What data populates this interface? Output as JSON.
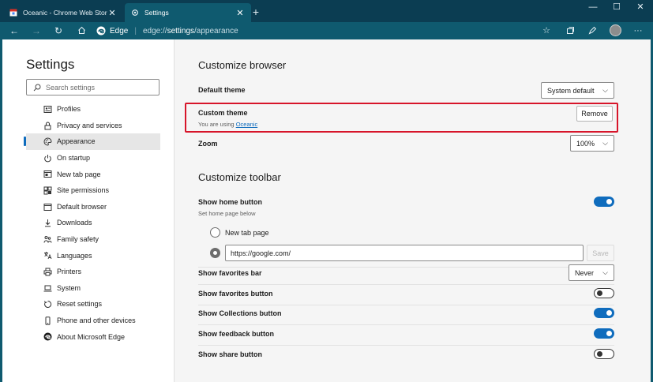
{
  "tabs": [
    {
      "title": "Oceanic - Chrome Web Store",
      "active": false,
      "icon": "chrome-web-store-icon"
    },
    {
      "title": "Settings",
      "active": true,
      "icon": "gear-icon"
    }
  ],
  "window_controls": {
    "minimize": "—",
    "maximize": "☐",
    "close": "✕"
  },
  "address_bar": {
    "brand": "Edge",
    "separator": "|",
    "url_prefix": "edge://",
    "url_host": "settings",
    "url_path": "/appearance"
  },
  "sidebar": {
    "title": "Settings",
    "search_placeholder": "Search settings",
    "items": [
      {
        "label": "Profiles",
        "icon": "person-card-icon"
      },
      {
        "label": "Privacy and services",
        "icon": "lock-icon"
      },
      {
        "label": "Appearance",
        "icon": "palette-icon",
        "selected": true
      },
      {
        "label": "On startup",
        "icon": "power-icon"
      },
      {
        "label": "New tab page",
        "icon": "new-tab-icon"
      },
      {
        "label": "Site permissions",
        "icon": "grid-permissions-icon"
      },
      {
        "label": "Default browser",
        "icon": "browser-window-icon"
      },
      {
        "label": "Downloads",
        "icon": "download-icon"
      },
      {
        "label": "Family safety",
        "icon": "family-icon"
      },
      {
        "label": "Languages",
        "icon": "language-icon"
      },
      {
        "label": "Printers",
        "icon": "printer-icon"
      },
      {
        "label": "System",
        "icon": "laptop-icon"
      },
      {
        "label": "Reset settings",
        "icon": "reset-icon"
      },
      {
        "label": "Phone and other devices",
        "icon": "phone-icon"
      },
      {
        "label": "About Microsoft Edge",
        "icon": "edge-logo-icon"
      }
    ]
  },
  "main": {
    "customize_browser": {
      "heading": "Customize browser",
      "default_theme": {
        "label": "Default theme",
        "value": "System default"
      },
      "custom_theme": {
        "label": "Custom theme",
        "sub_prefix": "You are using ",
        "sub_link": "Oceanic",
        "button": "Remove"
      },
      "zoom": {
        "label": "Zoom",
        "value": "100%"
      }
    },
    "customize_toolbar": {
      "heading": "Customize toolbar",
      "show_home_button": {
        "label": "Show home button",
        "sub": "Set home page below",
        "on": true
      },
      "home_options": {
        "new_tab_label": "New tab page",
        "url_value": "https://google.com/",
        "save_label": "Save"
      },
      "show_favorites_bar": {
        "label": "Show favorites bar",
        "value": "Never"
      },
      "toggles": [
        {
          "label": "Show favorites button",
          "on": false
        },
        {
          "label": "Show Collections button",
          "on": true
        },
        {
          "label": "Show feedback button",
          "on": true
        },
        {
          "label": "Show share button",
          "on": false
        }
      ]
    }
  },
  "colors": {
    "accent": "#0f6cbd",
    "titlebar": "#0b3d52",
    "toolbar": "#0f5a6f",
    "highlight": "#d7152a"
  }
}
